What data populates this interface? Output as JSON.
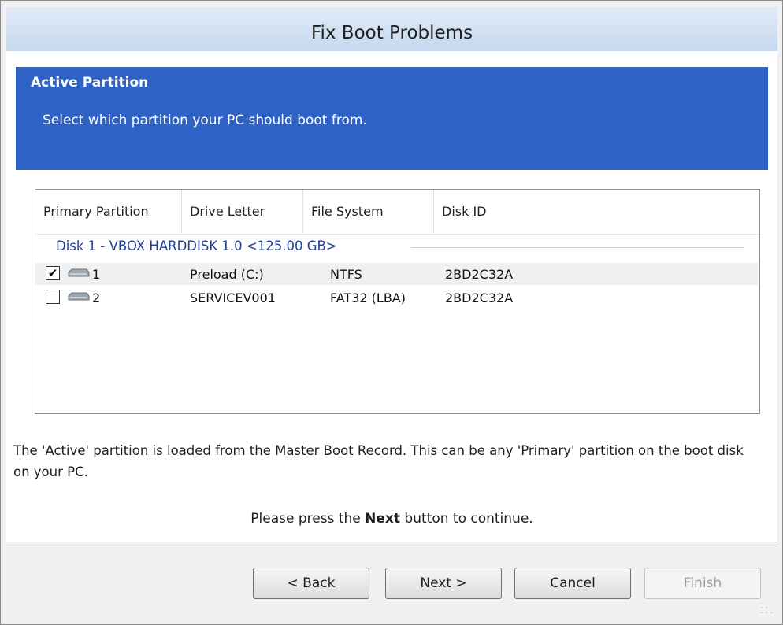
{
  "window": {
    "title": "Fix Boot Problems"
  },
  "banner": {
    "heading": "Active Partition",
    "subtitle": "Select which partition your PC should boot from."
  },
  "grid": {
    "columns": [
      "Primary Partition",
      "Drive Letter",
      "File System",
      "Disk ID"
    ],
    "group": "Disk 1 - VBOX HARDDISK 1.0  <125.00 GB>",
    "rows": [
      {
        "checked": true,
        "partition": "1",
        "drive": "Preload (C:)",
        "fs": "NTFS",
        "disk_id": "2BD2C32A",
        "icon": "hard-disk-icon"
      },
      {
        "checked": false,
        "partition": "2",
        "drive": "SERVICEV001",
        "fs": "FAT32 (LBA)",
        "disk_id": "2BD2C32A",
        "icon": "hard-disk-icon"
      }
    ]
  },
  "info": {
    "text": "The 'Active' partition is loaded from the Master Boot Record. This can be any 'Primary' partition on the boot disk on your PC.",
    "hint_prefix": "Please press the",
    "hint_bold": "Next",
    "hint_suffix": "button to continue."
  },
  "buttons": {
    "back": "< Back",
    "next": "Next >",
    "cancel": "Cancel",
    "finish": "Finish"
  },
  "colors": {
    "banner": "#2e62c4",
    "group_text": "#1f3f9c"
  }
}
